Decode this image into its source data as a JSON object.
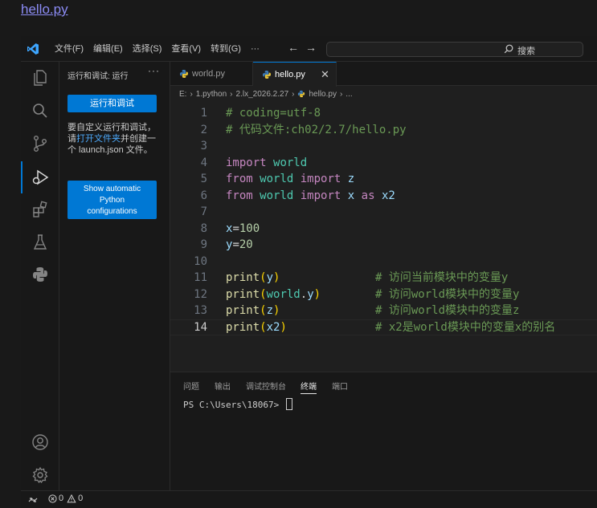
{
  "page_link": "hello.py",
  "menu": [
    "文件(F)",
    "编辑(E)",
    "选择(S)",
    "查看(V)",
    "转到(G)",
    "···"
  ],
  "search_label": "搜索",
  "sidebar": {
    "title": "运行和调试: 运行",
    "more": "···",
    "run_button": "运行和调试",
    "text_before": "要自定义运行和调试，请",
    "text_link": "打开文件夹",
    "text_after": "并创建一个 launch.json 文件。",
    "show_button_line1": "Show automatic",
    "show_button_line2": "Python",
    "show_button_line3": "configurations"
  },
  "tabs": [
    {
      "label": "world.py"
    },
    {
      "label": "hello.py"
    }
  ],
  "tab_close": "✕",
  "breadcrumb": [
    "E:",
    "1.python",
    "2.lx_2026.2.27",
    "hello.py",
    "..."
  ],
  "code": [
    {
      "no": "1",
      "parts": [
        {
          "c": "t-comment",
          "t": "# coding=utf-8"
        }
      ]
    },
    {
      "no": "2",
      "parts": [
        {
          "c": "t-comment",
          "t": "# 代码文件:ch02/2.7/hello.py"
        }
      ]
    },
    {
      "no": "3",
      "parts": []
    },
    {
      "no": "4",
      "parts": [
        {
          "c": "t-kw",
          "t": "import"
        },
        {
          "c": "t-plain",
          "t": " "
        },
        {
          "c": "t-module",
          "t": "world"
        }
      ]
    },
    {
      "no": "5",
      "parts": [
        {
          "c": "t-kw",
          "t": "from"
        },
        {
          "c": "t-plain",
          "t": " "
        },
        {
          "c": "t-module",
          "t": "world"
        },
        {
          "c": "t-plain",
          "t": " "
        },
        {
          "c": "t-kw",
          "t": "import"
        },
        {
          "c": "t-plain",
          "t": " "
        },
        {
          "c": "t-ident",
          "t": "z"
        }
      ]
    },
    {
      "no": "6",
      "parts": [
        {
          "c": "t-kw",
          "t": "from"
        },
        {
          "c": "t-plain",
          "t": " "
        },
        {
          "c": "t-module",
          "t": "world"
        },
        {
          "c": "t-plain",
          "t": " "
        },
        {
          "c": "t-kw",
          "t": "import"
        },
        {
          "c": "t-plain",
          "t": " "
        },
        {
          "c": "t-ident",
          "t": "x"
        },
        {
          "c": "t-plain",
          "t": " "
        },
        {
          "c": "t-kw",
          "t": "as"
        },
        {
          "c": "t-plain",
          "t": " "
        },
        {
          "c": "t-ident",
          "t": "x2"
        }
      ]
    },
    {
      "no": "7",
      "parts": []
    },
    {
      "no": "8",
      "parts": [
        {
          "c": "t-ident",
          "t": "x"
        },
        {
          "c": "t-op",
          "t": "="
        },
        {
          "c": "t-num",
          "t": "100"
        }
      ]
    },
    {
      "no": "9",
      "parts": [
        {
          "c": "t-ident",
          "t": "y"
        },
        {
          "c": "t-op",
          "t": "="
        },
        {
          "c": "t-num",
          "t": "20"
        }
      ]
    },
    {
      "no": "10",
      "parts": []
    },
    {
      "no": "11",
      "parts": [
        {
          "c": "t-func",
          "t": "print"
        },
        {
          "c": "t-paren",
          "t": "("
        },
        {
          "c": "t-ident",
          "t": "y"
        },
        {
          "c": "t-paren",
          "t": ")"
        }
      ],
      "comment": "# 访问当前模块中的变量y"
    },
    {
      "no": "12",
      "parts": [
        {
          "c": "t-func",
          "t": "print"
        },
        {
          "c": "t-paren",
          "t": "("
        },
        {
          "c": "t-module",
          "t": "world"
        },
        {
          "c": "t-op",
          "t": "."
        },
        {
          "c": "t-ident",
          "t": "y"
        },
        {
          "c": "t-paren",
          "t": ")"
        }
      ],
      "comment": "# 访问world模块中的变量y"
    },
    {
      "no": "13",
      "parts": [
        {
          "c": "t-func",
          "t": "print"
        },
        {
          "c": "t-paren",
          "t": "("
        },
        {
          "c": "t-ident",
          "t": "z"
        },
        {
          "c": "t-paren",
          "t": ")"
        }
      ],
      "comment": "# 访问world模块中的变量z"
    },
    {
      "no": "14",
      "parts": [
        {
          "c": "t-func",
          "t": "print"
        },
        {
          "c": "t-paren",
          "t": "("
        },
        {
          "c": "t-ident",
          "t": "x2"
        },
        {
          "c": "t-paren",
          "t": ")"
        }
      ],
      "comment": "# x2是world模块中的变量x的别名",
      "current": true
    }
  ],
  "panel_tabs": [
    "问题",
    "输出",
    "调试控制台",
    "终端",
    "端口"
  ],
  "panel_active_tab": "终端",
  "terminal_prompt": "PS C:\\Users\\18067> ",
  "status": {
    "errors": "0",
    "warnings": "0"
  },
  "colors": {
    "accent": "#0078d4",
    "background": "#1f1f1f",
    "link": "#4daafc"
  }
}
